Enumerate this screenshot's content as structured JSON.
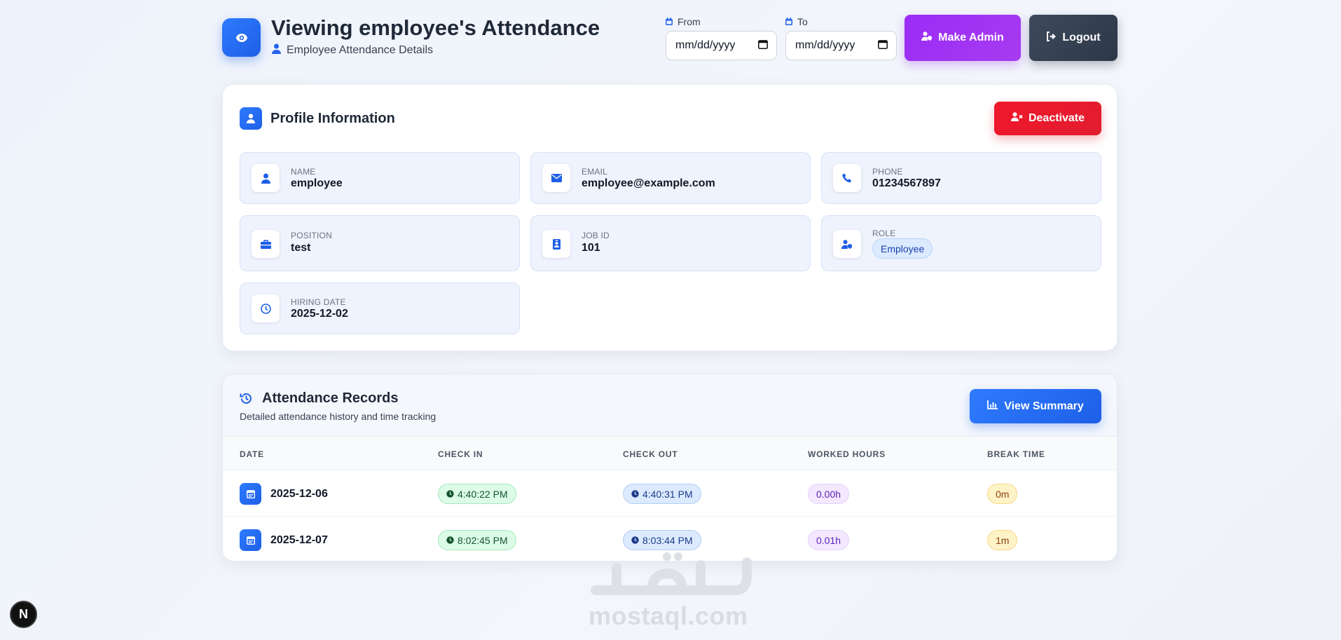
{
  "header": {
    "title": "Viewing employee's Attendance",
    "subtitle": "Employee Attendance Details",
    "from_label": "From",
    "to_label": "To",
    "from_value": "mm/dd/yyyy",
    "to_value": "mm/dd/yyyy",
    "make_admin_label": "Make Admin",
    "logout_label": "Logout"
  },
  "profile": {
    "section_title": "Profile Information",
    "deactivate_label": "Deactivate",
    "fields": [
      {
        "label": "NAME",
        "value": "employee",
        "icon": "user-icon"
      },
      {
        "label": "EMAIL",
        "value": "employee@example.com",
        "icon": "envelope-icon"
      },
      {
        "label": "PHONE",
        "value": "01234567897",
        "icon": "phone-icon"
      },
      {
        "label": "POSITION",
        "value": "test",
        "icon": "briefcase-icon"
      },
      {
        "label": "JOB ID",
        "value": "101",
        "icon": "id-badge-icon"
      },
      {
        "label": "ROLE",
        "value": "Employee",
        "icon": "user-shield-icon"
      },
      {
        "label": "HIRING DATE",
        "value": "2025-12-02",
        "icon": "clock-icon"
      }
    ]
  },
  "attendance": {
    "title": "Attendance Records",
    "subtitle": "Detailed attendance history and time tracking",
    "view_summary_label": "View Summary",
    "columns": [
      "DATE",
      "CHECK IN",
      "CHECK OUT",
      "WORKED HOURS",
      "BREAK TIME"
    ],
    "rows": [
      {
        "date": "2025-12-06",
        "check_in": "4:40:22 PM",
        "check_out": "4:40:31 PM",
        "worked": "0.00h",
        "break": "0m"
      },
      {
        "date": "2025-12-07",
        "check_in": "8:02:45 PM",
        "check_out": "8:03:44 PM",
        "worked": "0.01h",
        "break": "1m"
      }
    ]
  },
  "watermark": {
    "text": "mostaql.com"
  },
  "dev_badge": {
    "text": "N"
  },
  "colors": {
    "primary": "#2563eb",
    "admin": "#9333ea",
    "logout": "#334155",
    "danger": "#e11d2e"
  }
}
